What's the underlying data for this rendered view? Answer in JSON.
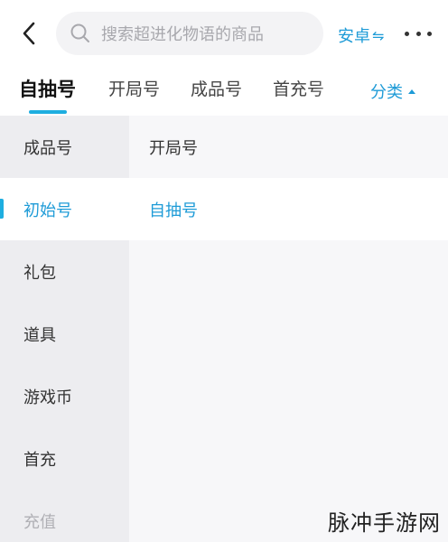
{
  "header": {
    "back_icon": "chevron-left-icon",
    "search_icon": "search-icon",
    "search_placeholder": "搜索超进化物语的商品",
    "platform_label": "安卓",
    "platform_swap_glyph": "⇋",
    "more_icon": "more-dots-icon"
  },
  "tabs": {
    "items": [
      {
        "label": "自抽号",
        "active": true
      },
      {
        "label": "开局号",
        "active": false
      },
      {
        "label": "成品号",
        "active": false
      },
      {
        "label": "首充号",
        "active": false
      }
    ],
    "category_label": "分类"
  },
  "sidebar": {
    "items": [
      {
        "label": "成品号"
      },
      {
        "label": "初始号",
        "active": true
      },
      {
        "label": "礼包"
      },
      {
        "label": "道具"
      },
      {
        "label": "游戏币"
      },
      {
        "label": "首充"
      },
      {
        "label": "充值"
      }
    ]
  },
  "panel": {
    "items": [
      {
        "label": "开局号"
      },
      {
        "label": "自抽号",
        "selected": true
      }
    ]
  },
  "watermark": {
    "text": "脉冲手游网"
  },
  "colors": {
    "accent": "#1e9bd7",
    "sidebar_bg": "#ededf0",
    "panel_bg": "#f7f7f9"
  }
}
